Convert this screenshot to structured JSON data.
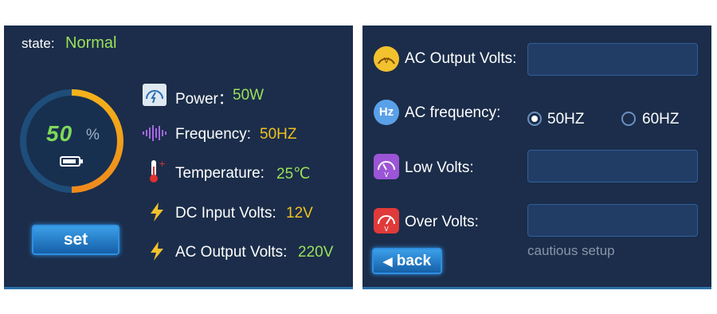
{
  "left_panel": {
    "state_label": "state:",
    "state_value": "Normal",
    "gauge": {
      "percent_text": "50",
      "percent_sign": "%",
      "level": 0.5
    },
    "set_button": "set",
    "metrics": [
      {
        "icon": "gauge-icon",
        "label": "Power：",
        "value": "50W",
        "color": "#9be05a"
      },
      {
        "icon": "waveform-icon",
        "label": "Frequency:",
        "value": "50HZ",
        "color": "#f0c020"
      },
      {
        "icon": "thermometer-icon",
        "label": "Temperature:",
        "value": "25℃",
        "color": "#9be05a"
      },
      {
        "icon": "lightning-icon",
        "label": "DC Input Volts:",
        "value": "12V",
        "color": "#f0c020"
      },
      {
        "icon": "lightning-icon",
        "label": "AC Output Volts:",
        "value": "220V",
        "color": "#9be05a"
      }
    ]
  },
  "right_panel": {
    "ac_output_label": "AC Output Volts:",
    "ac_frequency_label": "AC frequency:",
    "ac_frequency_icon_text": "Hz",
    "options": [
      {
        "label": "50HZ",
        "selected": true
      },
      {
        "label": "60HZ",
        "selected": false
      }
    ],
    "low_volts_label": "Low Volts:",
    "over_volts_label": "Over Volts:",
    "hint": "cautious setup",
    "back_button": "back"
  }
}
